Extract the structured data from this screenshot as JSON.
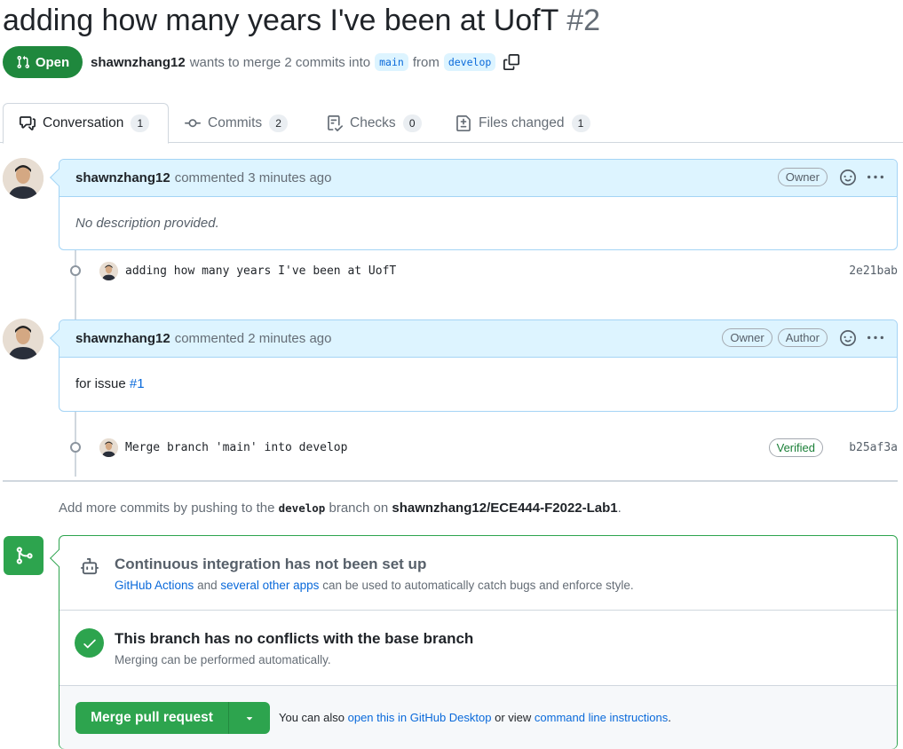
{
  "pr": {
    "title": "adding how many years I've been at UofT",
    "number": "#2",
    "state": "Open",
    "author": "shawnzhang12",
    "merge_text": "wants to merge 2 commits into",
    "base_branch": "main",
    "from_text": "from",
    "head_branch": "develop"
  },
  "tabs": [
    {
      "label": "Conversation",
      "count": "1",
      "icon": "comment-discussion-icon"
    },
    {
      "label": "Commits",
      "count": "2",
      "icon": "git-commit-icon"
    },
    {
      "label": "Checks",
      "count": "0",
      "icon": "checklist-icon"
    },
    {
      "label": "Files changed",
      "count": "1",
      "icon": "file-diff-icon"
    }
  ],
  "comments": [
    {
      "author": "shawnzhang12",
      "action": "commented 3 minutes ago",
      "labels": [
        "Owner"
      ],
      "body": "No description provided."
    },
    {
      "author": "shawnzhang12",
      "action": "commented 2 minutes ago",
      "labels": [
        "Owner",
        "Author"
      ],
      "body_prefix": "for issue",
      "body_link": "#1"
    }
  ],
  "commits": [
    {
      "message": "adding how many years I've been at UofT",
      "sha": "2e21bab"
    },
    {
      "message": "Merge branch 'main' into develop",
      "sha": "b25af3a",
      "badge": "Verified"
    }
  ],
  "push_hint": {
    "prefix": "Add more commits by pushing to the",
    "branch": "develop",
    "middle": "branch on",
    "repo": "shawnzhang12/ECE444-F2022-Lab1",
    "suffix": "."
  },
  "ci": {
    "title": "Continuous integration has not been set up",
    "link1": "GitHub Actions",
    "and": "and",
    "link2": "several other apps",
    "rest": "can be used to automatically catch bugs and enforce style."
  },
  "conflicts": {
    "title": "This branch has no conflicts with the base branch",
    "sub": "Merging can be performed automatically."
  },
  "merge": {
    "button": "Merge pull request",
    "alt_prefix": "You can also",
    "alt_link1": "open this in GitHub Desktop",
    "alt_middle": "or view",
    "alt_link2": "command line instructions",
    "alt_suffix": "."
  },
  "colors": {
    "open_green": "#1f883d",
    "link_blue": "#0969da",
    "comment_header_bg": "#ddf4ff"
  }
}
